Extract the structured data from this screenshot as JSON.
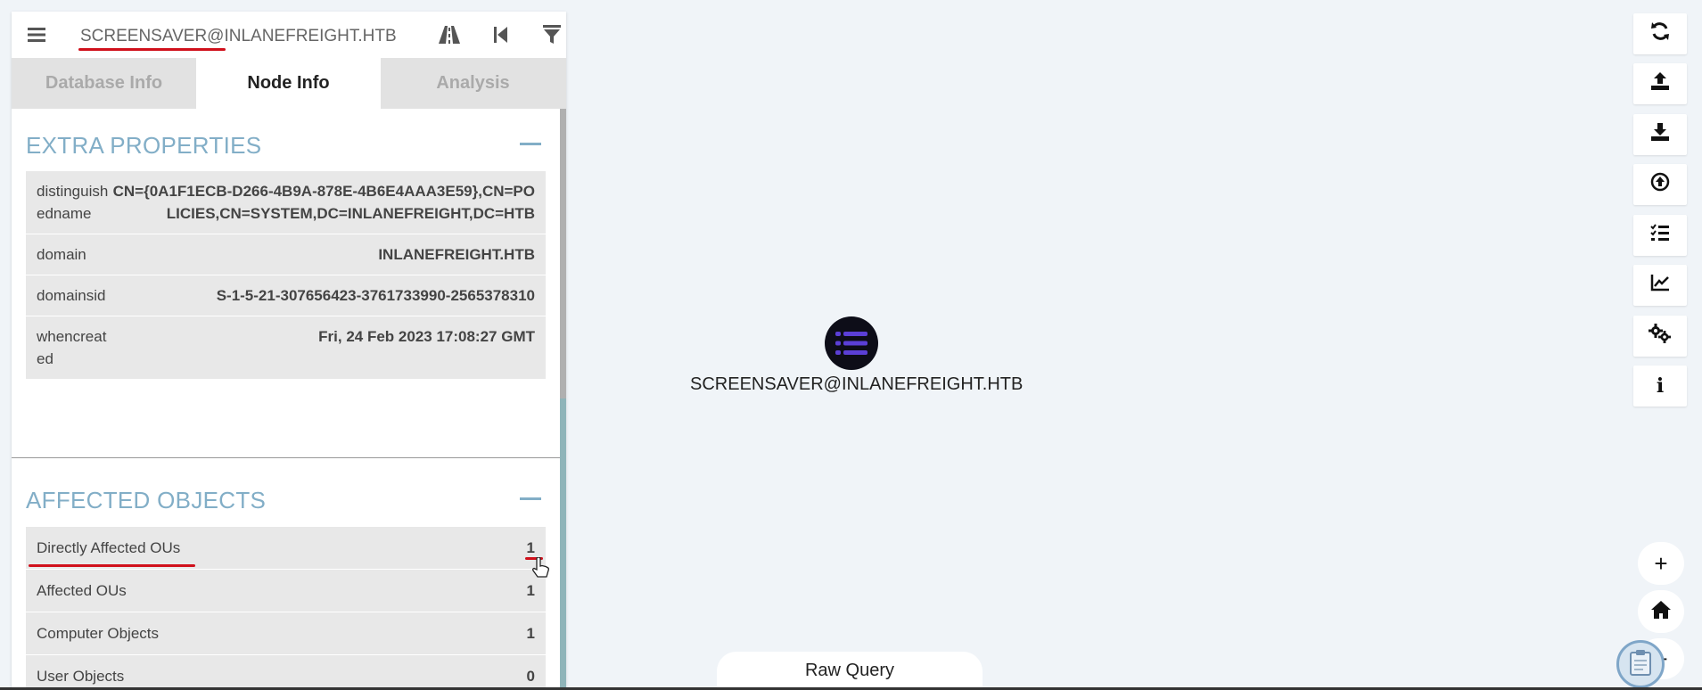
{
  "search": {
    "value": "SCREENSAVER@INLANEFREIGHT.HTB"
  },
  "tabs": [
    {
      "label": "Database Info"
    },
    {
      "label": "Node Info"
    },
    {
      "label": "Analysis"
    }
  ],
  "extra_properties": {
    "title": "EXTRA PROPERTIES",
    "rows": [
      {
        "key": "distinguishedname",
        "value": "CN={0A1F1ECB-D266-4B9A-878E-4B6E4AAA3E59},CN=POLICIES,CN=SYSTEM,DC=INLANEFREIGHT,DC=HTB"
      },
      {
        "key": "domain",
        "value": "INLANEFREIGHT.HTB"
      },
      {
        "key": "domainsid",
        "value": "S-1-5-21-307656423-3761733990-2565378310"
      },
      {
        "key": "whencreated",
        "value": "Fri, 24 Feb 2023 17:08:27 GMT"
      }
    ]
  },
  "affected_objects": {
    "title": "AFFECTED OBJECTS",
    "rows": [
      {
        "label": "Directly Affected OUs",
        "count": "1"
      },
      {
        "label": "Affected OUs",
        "count": "1"
      },
      {
        "label": "Computer Objects",
        "count": "1"
      },
      {
        "label": "User Objects",
        "count": "0"
      }
    ]
  },
  "graph": {
    "node_label": "SCREENSAVER@INLANEFREIGHT.HTB"
  },
  "toolbar": {
    "icons": [
      "refresh-icon",
      "upload-icon",
      "download-icon",
      "upload-circle-icon",
      "checklist-icon",
      "chart-icon",
      "settings-icon",
      "info-icon"
    ],
    "info_label": "i"
  },
  "zoom": {
    "plus": "+",
    "minus": "−"
  },
  "raw_query": {
    "label": "Raw Query"
  },
  "colors": {
    "accent": "#82aec7",
    "annotation": "#d0101b",
    "node": "#0d0d18",
    "node_icon": "#5b3fd6"
  }
}
